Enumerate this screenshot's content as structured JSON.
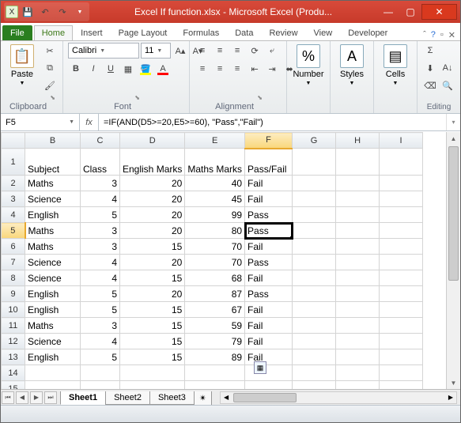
{
  "title": "Excel If function.xlsx - Microsoft Excel (Produ...",
  "qat": [
    "save",
    "undo",
    "redo"
  ],
  "tabs": {
    "file": "File",
    "list": [
      "Home",
      "Insert",
      "Page Layout",
      "Formulas",
      "Data",
      "Review",
      "View",
      "Developer"
    ],
    "active": "Home"
  },
  "ribbon": {
    "clipboard": {
      "label": "Clipboard",
      "paste": "Paste"
    },
    "font": {
      "label": "Font",
      "name": "Calibri",
      "size": "11"
    },
    "alignment": {
      "label": "Alignment"
    },
    "number": {
      "label": "Number",
      "btn": "Number"
    },
    "styles": {
      "label": "Styles",
      "btn": "Styles"
    },
    "cells": {
      "label": "Cells",
      "btn": "Cells"
    },
    "editing": {
      "label": "Editing"
    }
  },
  "namebox": "F5",
  "formula": "=IF(AND(D5>=20,E5>=60), \"Pass\",\"Fail\")",
  "columns": [
    "B",
    "C",
    "D",
    "E",
    "F",
    "G",
    "H",
    "I"
  ],
  "headers": {
    "B": "Subject",
    "C": "Class",
    "D": "English Marks",
    "E": "Maths Marks",
    "F": "Pass/Fail"
  },
  "rows": [
    {
      "n": 2,
      "B": "Maths",
      "C": 3,
      "D": 20,
      "E": 40,
      "F": "Fail"
    },
    {
      "n": 3,
      "B": "Science",
      "C": 4,
      "D": 20,
      "E": 45,
      "F": "Fail"
    },
    {
      "n": 4,
      "B": "English",
      "C": 5,
      "D": 20,
      "E": 99,
      "F": "Pass"
    },
    {
      "n": 5,
      "B": "Maths",
      "C": 3,
      "D": 20,
      "E": 80,
      "F": "Pass"
    },
    {
      "n": 6,
      "B": "Maths",
      "C": 3,
      "D": 15,
      "E": 70,
      "F": "Fail"
    },
    {
      "n": 7,
      "B": "Science",
      "C": 4,
      "D": 20,
      "E": 70,
      "F": "Pass"
    },
    {
      "n": 8,
      "B": "Science",
      "C": 4,
      "D": 15,
      "E": 68,
      "F": "Fail"
    },
    {
      "n": 9,
      "B": "English",
      "C": 5,
      "D": 20,
      "E": 87,
      "F": "Pass"
    },
    {
      "n": 10,
      "B": "English",
      "C": 5,
      "D": 15,
      "E": 67,
      "F": "Fail"
    },
    {
      "n": 11,
      "B": "Maths",
      "C": 3,
      "D": 15,
      "E": 59,
      "F": "Fail"
    },
    {
      "n": 12,
      "B": "Science",
      "C": 4,
      "D": 15,
      "E": 79,
      "F": "Fail"
    },
    {
      "n": 13,
      "B": "English",
      "C": 5,
      "D": 15,
      "E": 89,
      "F": "Fail"
    }
  ],
  "emptyRows": [
    14,
    15
  ],
  "selected": {
    "row": 5,
    "col": "F"
  },
  "sheets": {
    "list": [
      "Sheet1",
      "Sheet2",
      "Sheet3"
    ],
    "active": "Sheet1"
  }
}
